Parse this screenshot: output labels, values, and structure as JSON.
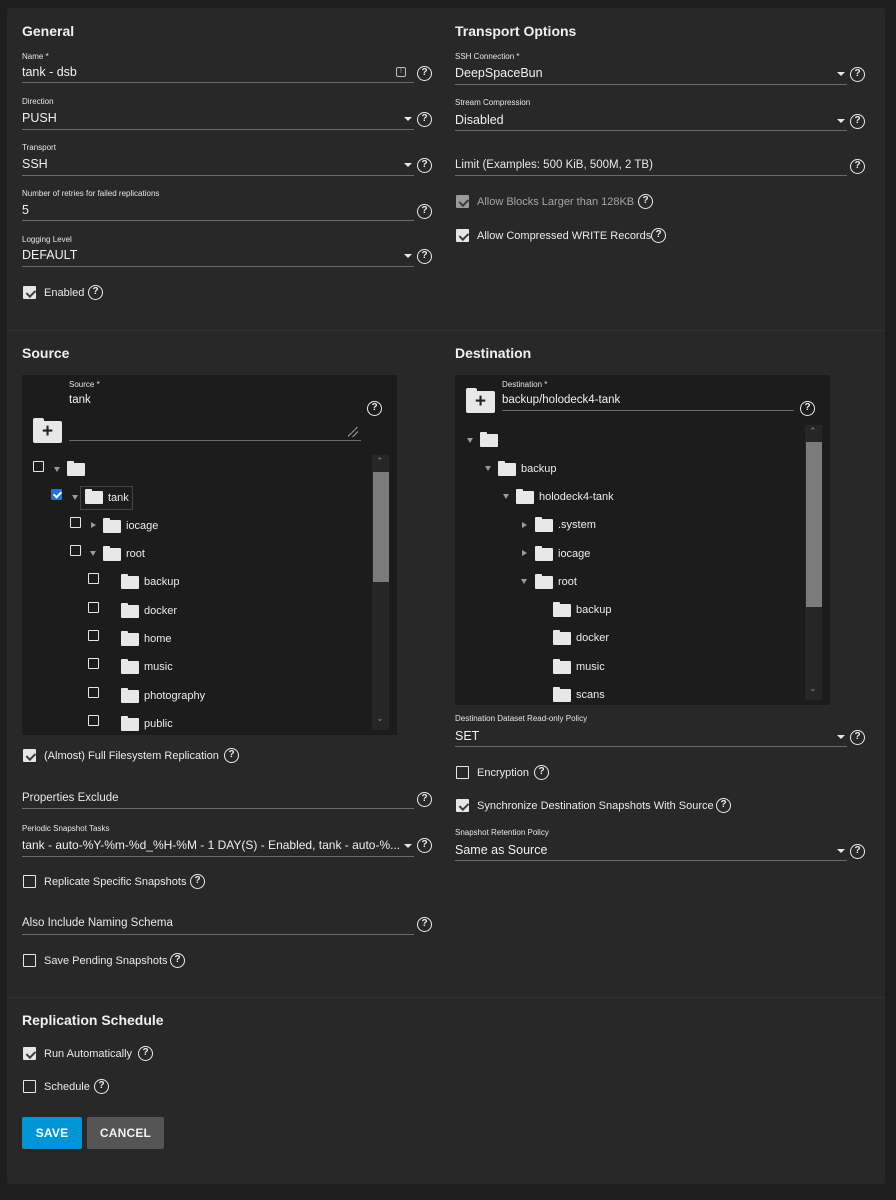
{
  "general": {
    "title": "General",
    "name_label": "Name *",
    "name_value": "tank - dsb",
    "direction_label": "Direction",
    "direction_value": "PUSH",
    "transport_label": "Transport",
    "transport_value": "SSH",
    "retries_label": "Number of retries for failed replications",
    "retries_value": "5",
    "logging_label": "Logging Level",
    "logging_value": "DEFAULT",
    "enabled_label": "Enabled"
  },
  "transport_options": {
    "title": "Transport Options",
    "ssh_label": "SSH Connection *",
    "ssh_value": "DeepSpaceBun",
    "compression_label": "Stream Compression",
    "compression_value": "Disabled",
    "limit_placeholder": "Limit (Examples: 500 KiB, 500M, 2 TB)",
    "large_blocks_label": "Allow Blocks Larger than 128KB",
    "compressed_write_label": "Allow Compressed WRITE Records"
  },
  "source": {
    "title": "Source",
    "field_label": "Source *",
    "field_value": "tank",
    "tree": {
      "tank": "tank",
      "iocage": "iocage",
      "root": "root",
      "children": [
        "backup",
        "docker",
        "home",
        "music",
        "photography",
        "public"
      ]
    },
    "full_fs_label": "(Almost) Full Filesystem Replication",
    "properties_exclude_placeholder": "Properties Exclude",
    "periodic_label": "Periodic Snapshot Tasks",
    "periodic_value": "tank - auto-%Y-%m-%d_%H-%M - 1 DAY(S) - Enabled, tank - auto-%...",
    "replicate_specific_label": "Replicate Specific Snapshots",
    "naming_schema_placeholder": "Also Include Naming Schema",
    "save_pending_label": "Save Pending Snapshots"
  },
  "destination": {
    "title": "Destination",
    "field_label": "Destination *",
    "field_value": "backup/holodeck4-tank",
    "tree": {
      "backup": "backup",
      "holodeck": "holodeck4-tank",
      "system": ".system",
      "iocage": "iocage",
      "root": "root",
      "children": [
        "backup",
        "docker",
        "music",
        "scans"
      ]
    },
    "readonly_label": "Destination Dataset Read-only Policy",
    "readonly_value": "SET",
    "encryption_label": "Encryption",
    "sync_label": "Synchronize Destination Snapshots With Source",
    "retention_label": "Snapshot Retention Policy",
    "retention_value": "Same as Source"
  },
  "schedule": {
    "title": "Replication Schedule",
    "run_auto_label": "Run Automatically",
    "schedule_label": "Schedule"
  },
  "actions": {
    "save": "SAVE",
    "cancel": "CANCEL"
  },
  "colors": {
    "background": "#1e1e1e",
    "card": "#282828",
    "accent_blue": "#0095d5",
    "checkbox_blue": "#1e73d8",
    "cancel_bg": "#555555"
  }
}
